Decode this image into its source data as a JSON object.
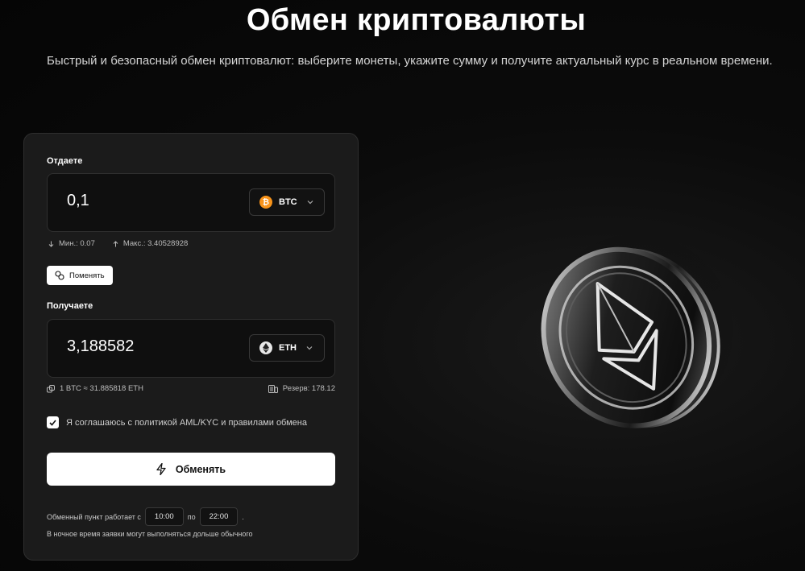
{
  "header": {
    "title": "Обмен криптовалюты",
    "subtitle": "Быстрый и безопасный обмен криптовалют: выберите монеты, укажите сумму и получите актуальный курс в реальном времени."
  },
  "give": {
    "label": "Отдаете",
    "amount": "0,1",
    "coin": "BTC",
    "min": "Мин.: 0.07",
    "max": "Макс.: 3.40528928"
  },
  "swap_label": "Поменять",
  "receive": {
    "label": "Получаете",
    "amount": "3,188582",
    "coin": "ETH",
    "rate": "1 BTC ≈ 31.885818 ETH",
    "reserve": "Резерв: 178.12"
  },
  "agreement": {
    "text": "Я соглашаюсь с политикой AML/KYC и правилами обмена",
    "checked": true
  },
  "exchange_button": "Обменять",
  "schedule": {
    "prefix": "Обменный пункт работает с",
    "open": "10:00",
    "between": "по",
    "close": "22:00",
    "suffix": ".",
    "night_note": "В ночное время заявки могут выполняться дольше обычного"
  },
  "colors": {
    "background": "#0b0b0b",
    "card": "#1b1b1b",
    "btc": "#f7931a",
    "button": "#ffffff"
  },
  "icons": [
    "bitcoin-icon",
    "ethereum-icon",
    "chevron-down-icon",
    "arrow-down-icon",
    "arrow-up-icon",
    "swap-icon",
    "link-icon",
    "coins-icon",
    "check-icon",
    "lightning-icon",
    "ethereum-coin-illustration"
  ]
}
